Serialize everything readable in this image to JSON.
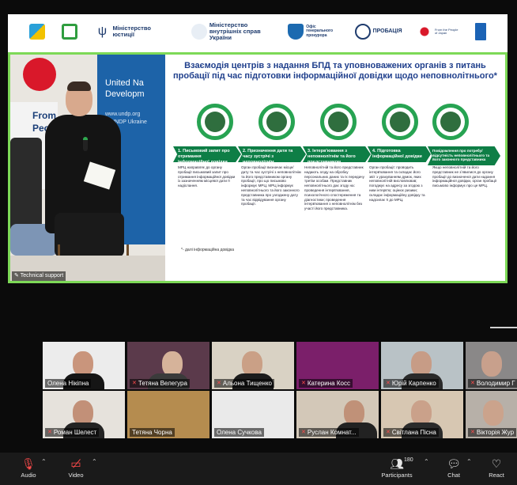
{
  "colors": {
    "accent_green": "#7dd957",
    "slide_title_blue": "#1f3f8c",
    "step_green": "#0e7e46",
    "muted_red": "#ff4b4b",
    "toolbar_bg": "#1a1a1a"
  },
  "logos": [
    {
      "icon": "flag-logo-icon",
      "text": ""
    },
    {
      "icon": "bracket-logo-icon",
      "text": ""
    },
    {
      "icon": "trident-icon",
      "text": "Міністерство юстиції"
    },
    {
      "icon": "ministry-seal-icon",
      "text": "Міністерство внутрішніх справ України"
    },
    {
      "icon": "prosecutor-shield-icon",
      "text": "Офіс генерального прокурора"
    },
    {
      "icon": "probation-logo-icon",
      "text": "ПРОБАЦІЯ"
    },
    {
      "icon": "japan-flag-icon",
      "text": "From the People of Japan"
    },
    {
      "icon": "undp-logo-icon",
      "text": ""
    }
  ],
  "speaker_video": {
    "banner_lines": [
      "United Na",
      "Developm"
    ],
    "banner_url": "www.undp.org",
    "banner_handle": "@UNDP Ukraine",
    "sign_lines": [
      "From",
      "People"
    ],
    "label": "Technical support"
  },
  "slide": {
    "title": "Взаємодія центрів з надання БПД та уповноважених органів з питань пробації під час підготовки інформаційної довідки щодо неповнолітнього*",
    "steps": [
      {
        "label": "1. Письмовий запит про отримання інформаційної довідки",
        "icon": "laptop-hand-icon"
      },
      {
        "label": "2. Призначення дати та часу зустрічі з неповнолітнім",
        "icon": "calendar-check-icon"
      },
      {
        "label": "3. Інтерв'ювання з неповнолітнім та його представником",
        "icon": "interview-icon"
      },
      {
        "label": "4. Підготовка інформаційної довідки",
        "icon": "people-meeting-icon"
      },
      {
        "label": "Повідомлення про потребу/відсутність неповнолітнього та його законного представника",
        "icon": "desk-person-icon"
      }
    ],
    "descriptions": [
      "МРЦ направляє до органу пробації письмовий запит про отримання інформаційної довідки із зазначенням місцевої дати її надіслання.",
      "Орган пробації визначає місце/дату та час зустрічі з неповнолітнім та його представником органу пробації, про що письмово інформує МРЦ. МРЦ інформує неповнолітнього та його законного представника про узгоджену дату та час відвідування органу пробації.",
      "Неповнолітній та його представник надають згоду на обробку персональних даних та їх передачу третім особам. Представник неповнолітнього дає згоду на: проведення інтерв'ювання, психологічного спостереження та діагностики; проведення інтерв'ювання з неповнолітнім без участі його представника.",
      "Орган пробації: проводить інтерв'ювання та складає його звіт з урахуванням думок, яких неповнолітній висловлював; погоджує на адресу за згодою з ним інтерв'ю; оцінює ризики; складає інформаційну довідку та надсилає її до МРЦ.",
      "Якщо неповнолітній та його представник не зʼявилися до органу пробації до визначеної дати надання інформаційної довідки, орган пробації письмово інформує про це МРЦ."
    ],
    "footnote": "*- далі інформаційна довідка"
  },
  "participants": [
    {
      "name": "Олена Нікіпна",
      "muted": false
    },
    {
      "name": "Тетяна Велегура",
      "muted": true
    },
    {
      "name": "Альона Тищенко",
      "muted": true
    },
    {
      "name": "Катерина Косс",
      "muted": true
    },
    {
      "name": "Юрій Карпенко",
      "muted": true
    },
    {
      "name": "Володимир Г",
      "muted": true
    },
    {
      "name": "Роман Шелест",
      "muted": true
    },
    {
      "name": "Тетяна Чорна",
      "muted": false
    },
    {
      "name": "Олена Сучкова",
      "muted": false
    },
    {
      "name": "Руслан Комнат...",
      "muted": true
    },
    {
      "name": "Світлана Пісна",
      "muted": true
    },
    {
      "name": "Вікторія Жур",
      "muted": true
    }
  ],
  "toolbar": {
    "audio": "Audio",
    "video": "Video",
    "participants": "Participants",
    "participants_count": "180",
    "chat": "Chat",
    "react": "React"
  }
}
